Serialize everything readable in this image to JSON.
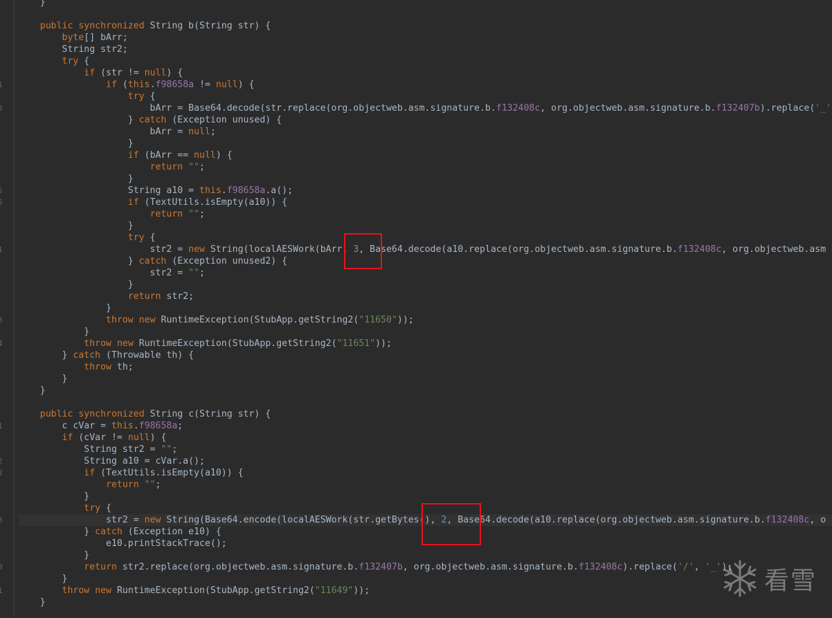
{
  "editor": {
    "lines": [
      "    }",
      "",
      "    public synchronized String b(String str) {",
      "        byte[] bArr;",
      "        String str2;",
      "        try {",
      "            if (str != null) {",
      "                if (this.f98658a != null) {",
      "                    try {",
      "                        bArr = Base64.decode(str.replace(org.objectweb.asm.signature.b.f132408c, org.objectweb.asm.signature.b.f132407b).replace('_'",
      "                    } catch (Exception unused) {",
      "                        bArr = null;",
      "                    }",
      "                    if (bArr == null) {",
      "                        return \"\";",
      "                    }",
      "                    String a10 = this.f98658a.a();",
      "                    if (TextUtils.isEmpty(a10)) {",
      "                        return \"\";",
      "                    }",
      "                    try {",
      "                        str2 = new String(localAESWork(bArr, 3, Base64.decode(a10.replace(org.objectweb.asm.signature.b.f132408c, org.objectweb.asm",
      "                    } catch (Exception unused2) {",
      "                        str2 = \"\";",
      "                    }",
      "                    return str2;",
      "                }",
      "                throw new RuntimeException(StubApp.getString2(\"11650\"));",
      "            }",
      "            throw new RuntimeException(StubApp.getString2(\"11651\"));",
      "        } catch (Throwable th) {",
      "            throw th;",
      "        }",
      "    }",
      "",
      "    public synchronized String c(String str) {",
      "        c cVar = this.f98658a;",
      "        if (cVar != null) {",
      "            String str2 = \"\";",
      "            String a10 = cVar.a();",
      "            if (TextUtils.isEmpty(a10)) {",
      "                return \"\";",
      "            }",
      "            try {",
      "                str2 = new String(Base64.encode(localAESWork(str.getBytes(), 2, Base64.decode(a10.replace(org.objectweb.asm.signature.b.f132408c, o",
      "            } catch (Exception e10) {",
      "                e10.printStackTrace();",
      "            }",
      "            return str2.replace(org.objectweb.asm.signature.b.f132407b, org.objectweb.asm.signature.b.f132408c).replace('/', '_');",
      "        }",
      "        throw new RuntimeException(StubApp.getString2(\"11649\"));",
      "    }"
    ],
    "gutter_numbers": [
      {
        "line": 7,
        "text": "1"
      },
      {
        "line": 9,
        "text": "3"
      },
      {
        "line": 16,
        "text": "5"
      },
      {
        "line": 17,
        "text": "6"
      },
      {
        "line": 21,
        "text": "1"
      },
      {
        "line": 27,
        "text": "3"
      },
      {
        "line": 29,
        "text": "4"
      },
      {
        "line": 36,
        "text": "1"
      },
      {
        "line": 39,
        "text": "2"
      },
      {
        "line": 40,
        "text": "3"
      },
      {
        "line": 44,
        "text": "3"
      },
      {
        "line": 48,
        "text": "0"
      },
      {
        "line": 50,
        "text": "1"
      }
    ],
    "caret_line": 44
  },
  "watermark": {
    "text": "看雪",
    "icon": "snowflake-icon"
  },
  "colors": {
    "background": "#2b2b2b",
    "keyword": "#cc7832",
    "string": "#6a8759",
    "number": "#6897bb",
    "highlight_box": "#e8121b"
  }
}
